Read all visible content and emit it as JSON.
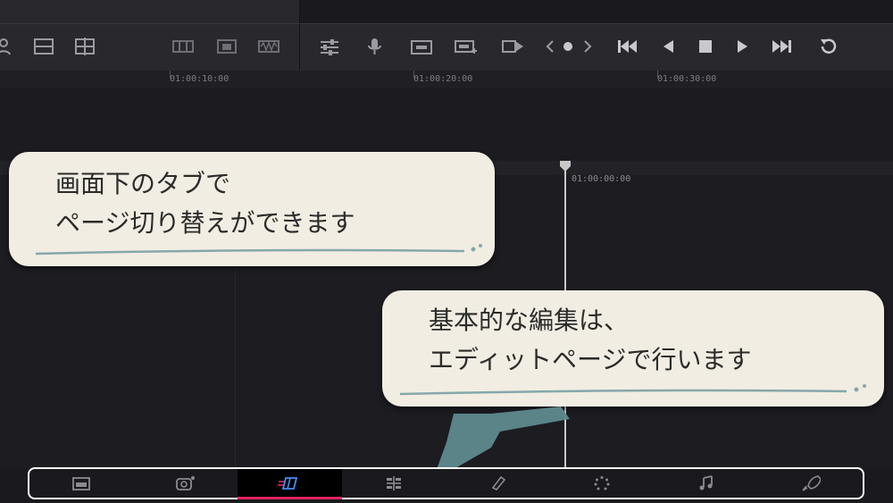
{
  "timeline": {
    "ruler_timecodes": [
      "01:00:10:00",
      "01:00:20:00",
      "01:00:30:00"
    ],
    "playhead_timecode": "01:00:00:00"
  },
  "toolbar": {
    "icons": [
      "person-icon",
      "single-view-icon",
      "split-view-icon",
      "clip-filmstrip-icon",
      "clip-thumbnail-icon",
      "clip-waveform-icon",
      "mixer-sliders-icon",
      "microphone-icon",
      "poi-icon",
      "poi-add-icon",
      "snapshot-play-icon",
      "prev-marker-icon",
      "marker-dot-icon",
      "next-marker-icon",
      "skip-back-icon",
      "reverse-play-icon",
      "stop-icon",
      "play-icon",
      "skip-forward-icon",
      "loop-icon"
    ]
  },
  "callouts": {
    "top": {
      "line1": "画面下のタブで",
      "line2": "ページ切り替えができます"
    },
    "bottom": {
      "line1": "基本的な編集は、",
      "line2": "エディットページで行います"
    }
  },
  "page_tabs": {
    "items": [
      "media-page-icon",
      "cut-page-icon",
      "edit-page-icon",
      "fusion-page-icon",
      "color-page-icon",
      "fairlight-page-icon",
      "music-page-icon",
      "deliver-page-icon"
    ],
    "active_index": 2,
    "accent_color": "#e0245e"
  },
  "colors": {
    "bubble": "#f1ede2",
    "arrow": "#5e8a8e",
    "frame": "#ffffff"
  }
}
